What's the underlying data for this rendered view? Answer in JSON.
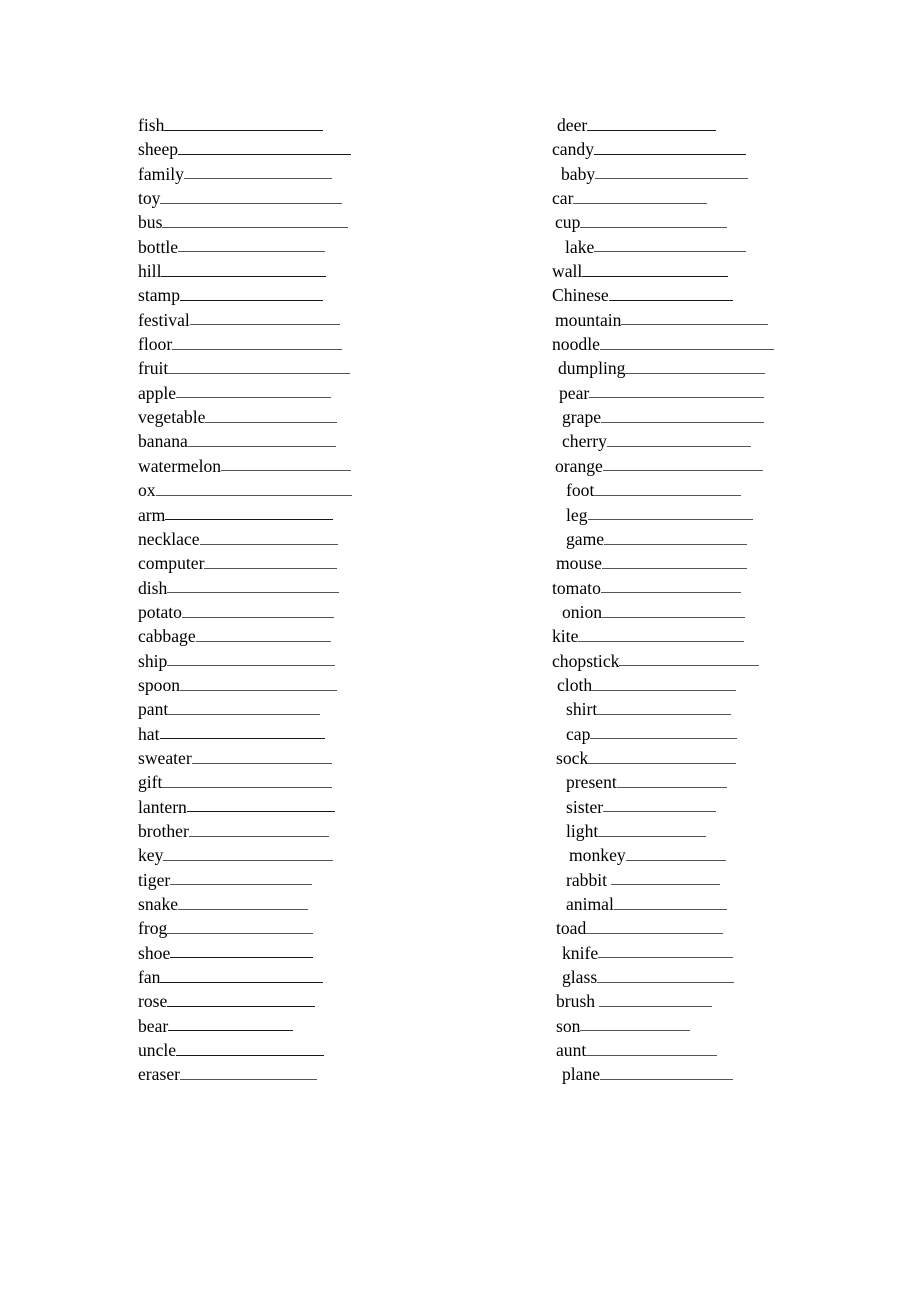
{
  "document": {
    "type": "vocabulary-worksheet",
    "page_background": "#ffffff",
    "text_color": "#000000",
    "column_count": 2,
    "rows_per_column": 40
  },
  "columns": {
    "left": {
      "name": "left-word-column",
      "rows": [
        {
          "word": "fish",
          "indent": 0,
          "line_width": 159,
          "faint": false,
          "gap": false
        },
        {
          "word": "sheep",
          "indent": 0,
          "line_width": 173,
          "faint": false,
          "gap": false
        },
        {
          "word": "family",
          "indent": 0,
          "line_width": 148,
          "faint": true,
          "gap": false
        },
        {
          "word": "toy",
          "indent": 0,
          "line_width": 182,
          "faint": true,
          "gap": false
        },
        {
          "word": "bus",
          "indent": 0,
          "line_width": 186,
          "faint": true,
          "gap": false
        },
        {
          "word": "bottle",
          "indent": 0,
          "line_width": 147,
          "faint": true,
          "gap": false
        },
        {
          "word": "hill",
          "indent": 0,
          "line_width": 165,
          "faint": false,
          "gap": false
        },
        {
          "word": "stamp",
          "indent": 0,
          "line_width": 143,
          "faint": false,
          "gap": false
        },
        {
          "word": "festival",
          "indent": 0,
          "line_width": 150,
          "faint": true,
          "gap": false
        },
        {
          "word": "floor",
          "indent": 0,
          "line_width": 170,
          "faint": true,
          "gap": false
        },
        {
          "word": "fruit",
          "indent": 0,
          "line_width": 182,
          "faint": true,
          "gap": false
        },
        {
          "word": "apple",
          "indent": 0,
          "line_width": 155,
          "faint": true,
          "gap": false
        },
        {
          "word": "vegetable",
          "indent": 0,
          "line_width": 132,
          "faint": true,
          "gap": false
        },
        {
          "word": "banana",
          "indent": 0,
          "line_width": 148,
          "faint": true,
          "gap": false
        },
        {
          "word": "watermelon",
          "indent": 0,
          "line_width": 130,
          "faint": true,
          "gap": false
        },
        {
          "word": "ox",
          "indent": 0,
          "line_width": 196,
          "faint": true,
          "gap": false
        },
        {
          "word": "arm",
          "indent": 0,
          "line_width": 168,
          "faint": false,
          "gap": false
        },
        {
          "word": "necklace",
          "indent": 0,
          "line_width": 138,
          "faint": true,
          "gap": false
        },
        {
          "word": "computer",
          "indent": 0,
          "line_width": 133,
          "faint": true,
          "gap": false
        },
        {
          "word": "dish",
          "indent": 0,
          "line_width": 172,
          "faint": true,
          "gap": false
        },
        {
          "word": "potato",
          "indent": 0,
          "line_width": 152,
          "faint": true,
          "gap": false
        },
        {
          "word": "cabbage",
          "indent": 0,
          "line_width": 135,
          "faint": true,
          "gap": false
        },
        {
          "word": "ship",
          "indent": 0,
          "line_width": 168,
          "faint": true,
          "gap": false
        },
        {
          "word": "spoon",
          "indent": 0,
          "line_width": 157,
          "faint": true,
          "gap": false
        },
        {
          "word": "pant",
          "indent": 0,
          "line_width": 152,
          "faint": true,
          "gap": false
        },
        {
          "word": "hat",
          "indent": 0,
          "line_width": 165,
          "faint": false,
          "gap": false
        },
        {
          "word": "sweater",
          "indent": 0,
          "line_width": 140,
          "faint": true,
          "gap": false
        },
        {
          "word": "gift",
          "indent": 0,
          "line_width": 170,
          "faint": true,
          "gap": false
        },
        {
          "word": "lantern",
          "indent": 0,
          "line_width": 148,
          "faint": false,
          "gap": false
        },
        {
          "word": "brother",
          "indent": 0,
          "line_width": 140,
          "faint": true,
          "gap": false
        },
        {
          "word": "key",
          "indent": 0,
          "line_width": 170,
          "faint": true,
          "gap": false
        },
        {
          "word": "tiger",
          "indent": 0,
          "line_width": 142,
          "faint": true,
          "gap": false
        },
        {
          "word": "snake",
          "indent": 0,
          "line_width": 130,
          "faint": true,
          "gap": false
        },
        {
          "word": "frog",
          "indent": 0,
          "line_width": 146,
          "faint": true,
          "gap": false
        },
        {
          "word": "shoe",
          "indent": 0,
          "line_width": 143,
          "faint": false,
          "gap": false
        },
        {
          "word": "fan",
          "indent": 0,
          "line_width": 163,
          "faint": false,
          "gap": false
        },
        {
          "word": "rose",
          "indent": 0,
          "line_width": 148,
          "faint": false,
          "gap": false
        },
        {
          "word": "bear",
          "indent": 0,
          "line_width": 125,
          "faint": false,
          "gap": false
        },
        {
          "word": "uncle",
          "indent": 0,
          "line_width": 148,
          "faint": false,
          "gap": false
        },
        {
          "word": "eraser",
          "indent": 0,
          "line_width": 137,
          "faint": true,
          "gap": false
        }
      ]
    },
    "right": {
      "name": "right-word-column",
      "rows": [
        {
          "word": "deer",
          "indent": 5,
          "line_width": 129,
          "faint": false,
          "gap": false
        },
        {
          "word": "candy",
          "indent": 0,
          "line_width": 152,
          "faint": false,
          "gap": false
        },
        {
          "word": "baby",
          "indent": 9,
          "line_width": 153,
          "faint": true,
          "gap": false
        },
        {
          "word": "car",
          "indent": 0,
          "line_width": 134,
          "faint": true,
          "gap": false
        },
        {
          "word": "cup",
          "indent": 3,
          "line_width": 147,
          "faint": true,
          "gap": false
        },
        {
          "word": "lake",
          "indent": 13,
          "line_width": 152,
          "faint": true,
          "gap": false
        },
        {
          "word": "wall",
          "indent": 0,
          "line_width": 146,
          "faint": false,
          "gap": false
        },
        {
          "word": "Chinese",
          "indent": 0,
          "line_width": 124,
          "faint": false,
          "gap": false
        },
        {
          "word": "mountain",
          "indent": 3,
          "line_width": 147,
          "faint": true,
          "gap": false
        },
        {
          "word": "noodle",
          "indent": 0,
          "line_width": 174,
          "faint": true,
          "gap": false
        },
        {
          "word": "dumpling",
          "indent": 6,
          "line_width": 140,
          "faint": true,
          "gap": false
        },
        {
          "word": "pear",
          "indent": 7,
          "line_width": 175,
          "faint": true,
          "gap": false
        },
        {
          "word": "grape",
          "indent": 10,
          "line_width": 163,
          "faint": true,
          "gap": false
        },
        {
          "word": "cherry",
          "indent": 10,
          "line_width": 144,
          "faint": true,
          "gap": false
        },
        {
          "word": "orange",
          "indent": 3,
          "line_width": 160,
          "faint": true,
          "gap": false
        },
        {
          "word": "foot",
          "indent": 14,
          "line_width": 147,
          "faint": true,
          "gap": false
        },
        {
          "word": "leg",
          "indent": 14,
          "line_width": 165,
          "faint": true,
          "gap": false
        },
        {
          "word": "game",
          "indent": 14,
          "line_width": 143,
          "faint": true,
          "gap": false
        },
        {
          "word": "mouse",
          "indent": 4,
          "line_width": 145,
          "faint": true,
          "gap": false
        },
        {
          "word": "tomato",
          "indent": 0,
          "line_width": 140,
          "faint": true,
          "gap": false
        },
        {
          "word": "onion",
          "indent": 10,
          "line_width": 143,
          "faint": true,
          "gap": false
        },
        {
          "word": "kite",
          "indent": 0,
          "line_width": 166,
          "faint": true,
          "gap": false
        },
        {
          "word": "chopstick",
          "indent": 0,
          "line_width": 140,
          "faint": true,
          "gap": false
        },
        {
          "word": "cloth",
          "indent": 5,
          "line_width": 144,
          "faint": true,
          "gap": false
        },
        {
          "word": "shirt",
          "indent": 14,
          "line_width": 134,
          "faint": true,
          "gap": false
        },
        {
          "word": "cap",
          "indent": 14,
          "line_width": 147,
          "faint": true,
          "gap": false
        },
        {
          "word": "sock",
          "indent": 4,
          "line_width": 148,
          "faint": true,
          "gap": false
        },
        {
          "word": "present",
          "indent": 14,
          "line_width": 110,
          "faint": true,
          "gap": false
        },
        {
          "word": "sister",
          "indent": 14,
          "line_width": 113,
          "faint": true,
          "gap": false
        },
        {
          "word": "light",
          "indent": 14,
          "line_width": 108,
          "faint": true,
          "gap": false
        },
        {
          "word": "monkey",
          "indent": 17,
          "line_width": 100,
          "faint": true,
          "gap": false
        },
        {
          "word": "rabbit",
          "indent": 14,
          "line_width": 109,
          "faint": true,
          "gap": true
        },
        {
          "word": "animal",
          "indent": 14,
          "line_width": 113,
          "faint": true,
          "gap": false
        },
        {
          "word": "toad",
          "indent": 4,
          "line_width": 137,
          "faint": true,
          "gap": false
        },
        {
          "word": "knife",
          "indent": 10,
          "line_width": 135,
          "faint": true,
          "gap": false
        },
        {
          "word": "glass",
          "indent": 10,
          "line_width": 137,
          "faint": true,
          "gap": false
        },
        {
          "word": "brush",
          "indent": 4,
          "line_width": 113,
          "faint": true,
          "gap": true
        },
        {
          "word": "son",
          "indent": 4,
          "line_width": 110,
          "faint": true,
          "gap": false
        },
        {
          "word": "aunt",
          "indent": 4,
          "line_width": 131,
          "faint": true,
          "gap": false
        },
        {
          "word": "plane",
          "indent": 10,
          "line_width": 133,
          "faint": true,
          "gap": false
        }
      ]
    }
  }
}
